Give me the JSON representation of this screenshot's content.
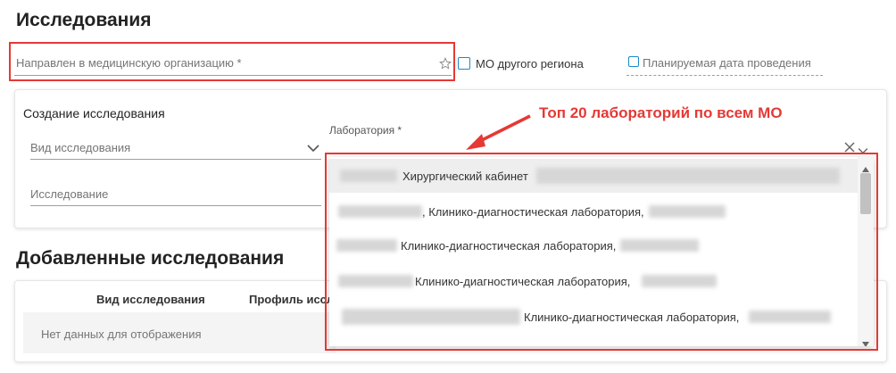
{
  "research": {
    "title": "Исследования",
    "direction_field": {
      "placeholder": "Направлен в медицинскую организацию *"
    },
    "other_region_label": "МО другого региона",
    "planned_date_label": "Планируемая дата проведения"
  },
  "create": {
    "title": "Создание исследования",
    "type_field_label": "Вид исследования",
    "research_field_label": "Исследование",
    "lab_field_label": "Лаборатория *"
  },
  "annotation": "Топ 20 лабораторий по всем МО",
  "dropdown": {
    "options": [
      "Хирургический кабинет",
      ", Клинико-диагностическая лаборатория,",
      "Клинико-диагностическая лаборатория,",
      "Клинико-диагностическая лаборатория,",
      "Клинико-диагностическая лаборатория,"
    ]
  },
  "added": {
    "title": "Добавленные исследования",
    "columns": [
      "Вид исследования",
      "Профиль иссле"
    ],
    "empty_text": "Нет данных для отображения"
  },
  "colors": {
    "accent": "#e53935",
    "brand": "#1e88c7"
  }
}
